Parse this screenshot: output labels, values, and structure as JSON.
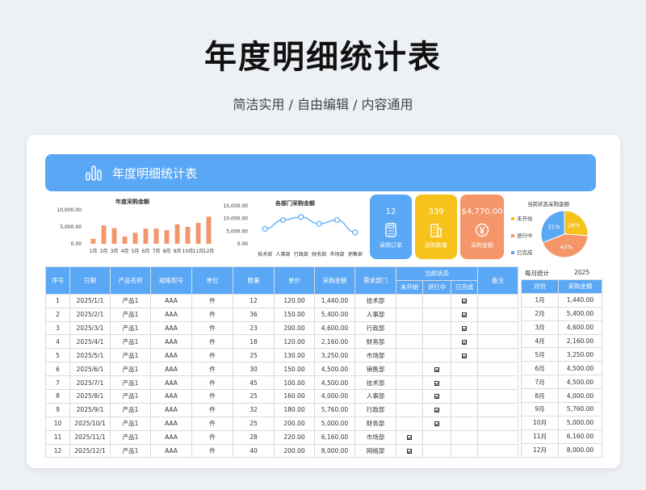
{
  "page": {
    "title": "年度明细统计表",
    "subtitle": "简洁实用 / 自由编辑 / 内容通用"
  },
  "banner": {
    "title": "年度明细统计表",
    "icon": "bar-chart-icon"
  },
  "colors": {
    "accent": "#5aa8f5",
    "bar": "#f4956a",
    "line": "#5aa8f5",
    "kpi_blue": "#5aa8f5",
    "kpi_yellow": "#f7c21b",
    "kpi_orange": "#f4956a"
  },
  "kpis": [
    {
      "value": "12",
      "label": "采购订单",
      "icon": "calculator-icon",
      "color": "#5aa8f5"
    },
    {
      "value": "339",
      "label": "采购数量",
      "icon": "building-icon",
      "color": "#f7c21b"
    },
    {
      "value": "$4,770.00",
      "label": "采购金额",
      "icon": "yen-icon",
      "color": "#f4956a"
    }
  ],
  "chart_data": [
    {
      "type": "bar",
      "title": "年度采购金额",
      "categories": [
        "1月",
        "2月",
        "3月",
        "4月",
        "5月",
        "6月",
        "7月",
        "8月",
        "9月",
        "10月",
        "11月",
        "12月"
      ],
      "values": [
        1440,
        5400,
        4600,
        2160,
        3250,
        4500,
        4500,
        4000,
        5760,
        5000,
        6160,
        8000
      ],
      "ylim": [
        0,
        10000
      ],
      "yticks": [
        "0.00",
        "5,000.00",
        "10,000.00"
      ]
    },
    {
      "type": "line",
      "title": "各部门采购金额",
      "categories": [
        "技术部",
        "人事部",
        "行政部",
        "财务部",
        "市场部",
        "销售部"
      ],
      "values": [
        5900,
        9400,
        10600,
        7900,
        9400,
        4500
      ],
      "ylim": [
        0,
        15000
      ],
      "yticks": [
        "0.00",
        "5,000.00",
        "10,000.00",
        "15,000.00"
      ]
    },
    {
      "type": "pie",
      "title": "当前状态采购金额",
      "slices": [
        {
          "name": "未开始",
          "percent": 26,
          "label": "26%",
          "color": "#f7c21b"
        },
        {
          "name": "进行中",
          "percent": 43,
          "label": "43%",
          "color": "#f4956a"
        },
        {
          "name": "已完成",
          "percent": 31,
          "label": "31%",
          "color": "#5aa8f5"
        }
      ],
      "legend": "left"
    }
  ],
  "table": {
    "headers": [
      "序号",
      "日期",
      "产品名称",
      "规格型号",
      "单位",
      "数量",
      "单价",
      "采购金额",
      "需求部门",
      "当前状态",
      "备注"
    ],
    "status_headers": [
      "未开始",
      "进行中",
      "已完成"
    ],
    "rows": [
      [
        "1",
        "2025/1/1",
        "产品1",
        "AAA",
        "件",
        "12",
        "120.00",
        "1,440.00",
        "技术部",
        "",
        "",
        "✓",
        ""
      ],
      [
        "2",
        "2025/2/1",
        "产品1",
        "AAA",
        "件",
        "36",
        "150.00",
        "5,400.00",
        "人事部",
        "",
        "",
        "✓",
        ""
      ],
      [
        "3",
        "2025/3/1",
        "产品1",
        "AAA",
        "件",
        "23",
        "200.00",
        "4,600.00",
        "行政部",
        "",
        "",
        "✓",
        ""
      ],
      [
        "4",
        "2025/4/1",
        "产品1",
        "AAA",
        "件",
        "18",
        "120.00",
        "2,160.00",
        "财务部",
        "",
        "",
        "✓",
        ""
      ],
      [
        "5",
        "2025/5/1",
        "产品1",
        "AAA",
        "件",
        "25",
        "130.00",
        "3,250.00",
        "市场部",
        "",
        "",
        "✓",
        ""
      ],
      [
        "6",
        "2025/6/1",
        "产品1",
        "AAA",
        "件",
        "30",
        "150.00",
        "4,500.00",
        "销售部",
        "",
        "✓",
        "",
        ""
      ],
      [
        "7",
        "2025/7/1",
        "产品1",
        "AAA",
        "件",
        "45",
        "100.00",
        "4,500.00",
        "技术部",
        "",
        "✓",
        "",
        ""
      ],
      [
        "8",
        "2025/8/1",
        "产品1",
        "AAA",
        "件",
        "25",
        "160.00",
        "4,000.00",
        "人事部",
        "",
        "✓",
        "",
        ""
      ],
      [
        "9",
        "2025/9/1",
        "产品1",
        "AAA",
        "件",
        "32",
        "180.00",
        "5,760.00",
        "行政部",
        "",
        "✓",
        "",
        ""
      ],
      [
        "10",
        "2025/10/1",
        "产品1",
        "AAA",
        "件",
        "25",
        "200.00",
        "5,000.00",
        "财务部",
        "",
        "✓",
        "",
        ""
      ],
      [
        "11",
        "2025/11/1",
        "产品1",
        "AAA",
        "件",
        "28",
        "220.00",
        "6,160.00",
        "市场部",
        "✓",
        "",
        "",
        ""
      ],
      [
        "12",
        "2025/12/1",
        "产品1",
        "AAA",
        "件",
        "40",
        "200.00",
        "8,000.00",
        "网络部",
        "✓",
        "",
        "",
        ""
      ]
    ]
  },
  "monthly": {
    "title": "每月统计",
    "year": "2025",
    "headers": [
      "月份",
      "采购金额"
    ],
    "rows": [
      [
        "1月",
        "1,440.00"
      ],
      [
        "2月",
        "5,400.00"
      ],
      [
        "3月",
        "4,600.00"
      ],
      [
        "4月",
        "2,160.00"
      ],
      [
        "5月",
        "3,250.00"
      ],
      [
        "6月",
        "4,500.00"
      ],
      [
        "7月",
        "4,500.00"
      ],
      [
        "8月",
        "4,000.00"
      ],
      [
        "9月",
        "5,760.00"
      ],
      [
        "10月",
        "5,000.00"
      ],
      [
        "11月",
        "6,160.00"
      ],
      [
        "12月",
        "8,000.00"
      ]
    ]
  }
}
